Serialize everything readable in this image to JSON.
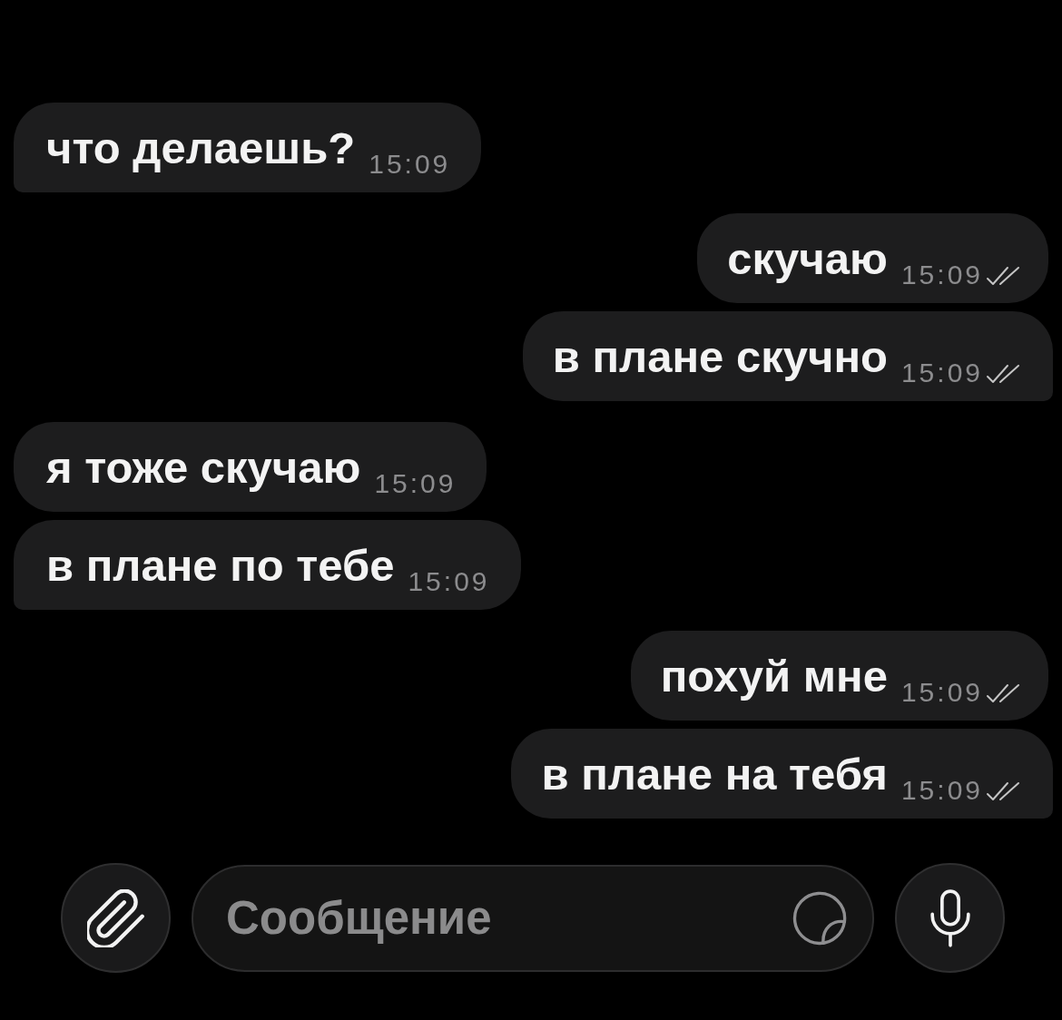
{
  "messages": [
    {
      "kind": "incoming",
      "text": "что делаешь?",
      "time": "15:09",
      "read": false
    },
    {
      "kind": "outgoing",
      "text": "скучаю",
      "time": "15:09",
      "read": true
    },
    {
      "kind": "outgoing",
      "text": "в плане скучно",
      "time": "15:09",
      "read": true
    },
    {
      "kind": "incoming",
      "text": "я тоже скучаю",
      "time": "15:09",
      "read": false
    },
    {
      "kind": "incoming",
      "text": "в плане по тебе",
      "time": "15:09",
      "read": false
    },
    {
      "kind": "outgoing",
      "text": "похуй мне",
      "time": "15:09",
      "read": true
    },
    {
      "kind": "outgoing",
      "text": "в плане на тебя",
      "time": "15:09",
      "read": true
    }
  ],
  "composer": {
    "placeholder": "Сообщение"
  }
}
